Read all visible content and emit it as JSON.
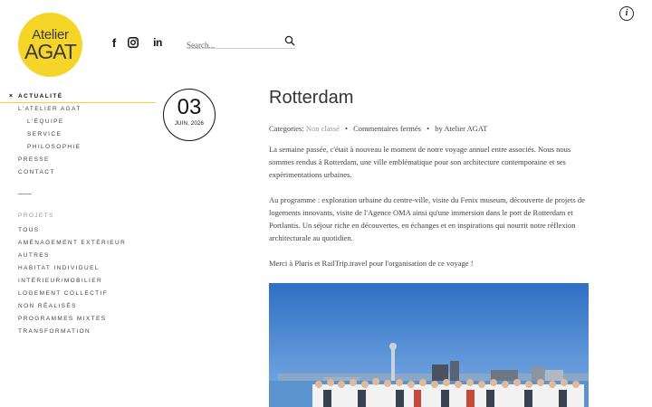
{
  "brand": {
    "line1": "Atelier",
    "line2": "AGAT",
    "color": "#f6d529"
  },
  "social": [
    {
      "icon": "facebook-icon",
      "glyph": "f"
    },
    {
      "icon": "instagram-icon"
    },
    {
      "icon": "linkedin-icon",
      "glyph": "in"
    }
  ],
  "search": {
    "placeholder": "Search..."
  },
  "info_icon": {
    "glyph": "i"
  },
  "nav": {
    "active_mark": "×",
    "items": [
      {
        "label": "Actualité"
      },
      {
        "label": "L'atelier AGAT"
      },
      {
        "label": "L'équipe"
      },
      {
        "label": "Service"
      },
      {
        "label": "Philosophie"
      },
      {
        "label": "Presse"
      },
      {
        "label": "Contact"
      }
    ],
    "projects_heading": "Projets",
    "projects": [
      {
        "label": "Tous"
      },
      {
        "label": "Aménagement extérieur"
      },
      {
        "label": "Autres"
      },
      {
        "label": "Habitat individuel"
      },
      {
        "label": "Intérieur/mobilier"
      },
      {
        "label": "Logement collectif"
      },
      {
        "label": "Non réalisés"
      },
      {
        "label": "Programmes mixtes"
      },
      {
        "label": "Transformation"
      }
    ]
  },
  "post": {
    "day": "03",
    "month": "JUIN, 2026",
    "title": "Rotterdam",
    "meta": {
      "categories_prefix": "Categories:",
      "category": "Non classé",
      "comments": "Commentaires fermés",
      "author": "by Atelier AGAT",
      "separator": "•"
    },
    "paragraphs": [
      "La semaine passée, c'était à nouveau le moment de notre voyage annuel entre associés. Nous nous sommes rendus à Rotterdam, une ville emblématique pour son architecture contemporaine et ses expérimentations urbaines.",
      "Au programme : exploration urbaine du centre-ville, visite du Fenix museum, découverte de projets de logements innovants, visite de l'Agence OMA ainsi qu'une immersion dans le port de Rotterdam et Portlantis. Un séjour riche en découvertes, en échanges et en inspirations qui nourrit notre réflexion architecturale au quotidien.",
      "Merci à Pluris et RailTrip.travel pour l'organisation de ce voyage !"
    ]
  },
  "photo": {
    "sky": "#3b7fcf",
    "water": "#4a8fd6"
  }
}
